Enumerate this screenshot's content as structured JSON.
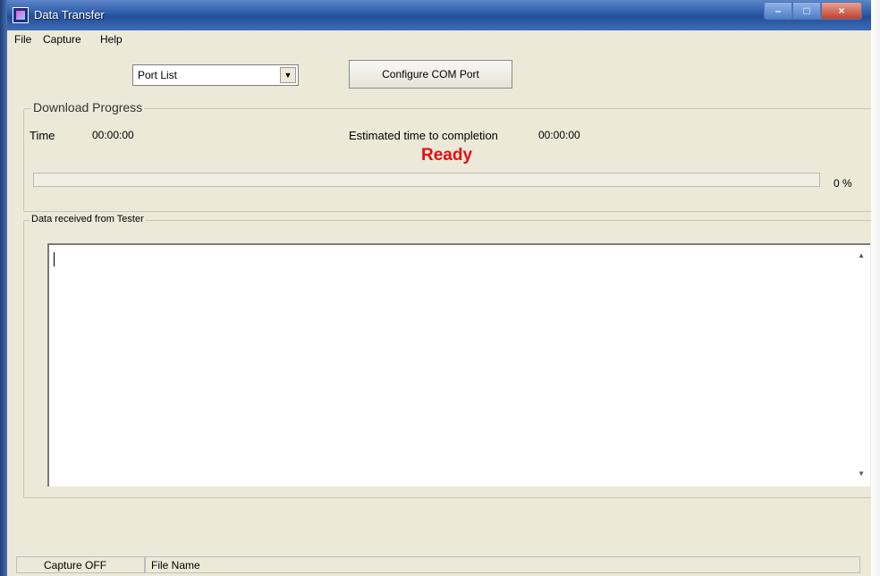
{
  "window": {
    "title": "Data Transfer"
  },
  "menu": {
    "file": "File",
    "capture": "Capture",
    "help": "Help"
  },
  "port": {
    "selected": "Port List"
  },
  "configure_button": "Configure COM Port",
  "progress": {
    "group_label": "Download Progress",
    "time_label": "Time",
    "time_value": "00:00:00",
    "eta_label": "Estimated time to completion",
    "eta_value": "00:00:00",
    "status": "Ready",
    "status_color": "#e60d13",
    "percent_text": "0 %",
    "percent": 0
  },
  "data_area": {
    "group_label": "Data received from Tester",
    "content": ""
  },
  "statusbar": {
    "capture": "Capture OFF",
    "file_name": "File Name"
  },
  "icons": [
    "app-icon",
    "minimize-icon",
    "maximize-icon",
    "close-icon",
    "dropdown-arrow-icon",
    "scroll-up-icon",
    "scroll-down-icon"
  ]
}
